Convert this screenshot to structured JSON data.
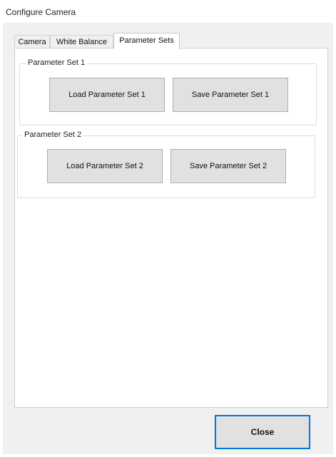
{
  "window": {
    "title": "Configure Camera"
  },
  "tabs": [
    {
      "label": "Camera",
      "active": false
    },
    {
      "label": "White Balance",
      "active": false
    },
    {
      "label": "Parameter Sets",
      "active": true
    }
  ],
  "parameter_sets": [
    {
      "group_label": "Parameter Set 1",
      "load_label": "Load Parameter Set 1",
      "save_label": "Save Parameter Set 1"
    },
    {
      "group_label": "Parameter Set 2",
      "load_label": "Load Parameter Set 2",
      "save_label": "Save Parameter Set 2"
    }
  ],
  "footer": {
    "close_label": "Close"
  },
  "colors": {
    "focus_border": "#0078d7",
    "button_face": "#e1e1e1",
    "dialog_background": "#f0f0f0"
  }
}
